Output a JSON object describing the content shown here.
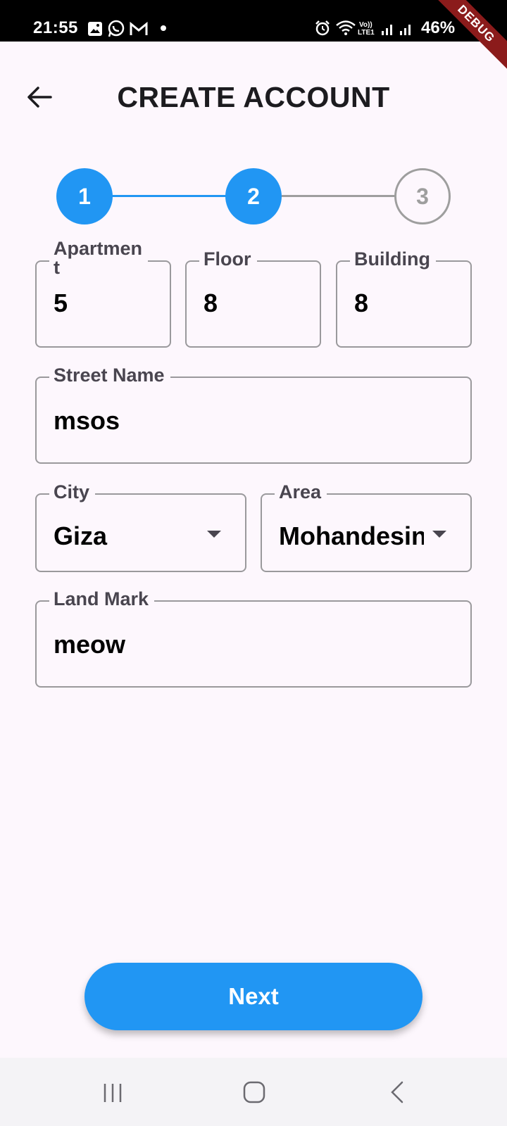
{
  "status_bar": {
    "time": "21:55",
    "battery": "46%",
    "debug_label": "DEBUG",
    "icons": [
      "gallery-icon",
      "whatsapp-icon",
      "gmail-icon",
      "alarm-icon",
      "wifi-icon",
      "volte-icon",
      "signal-icon",
      "signal-icon"
    ]
  },
  "header": {
    "title": "CREATE ACCOUNT",
    "back_icon": "arrow-back-icon"
  },
  "stepper": {
    "steps": [
      {
        "label": "1",
        "state": "active"
      },
      {
        "label": "2",
        "state": "active"
      },
      {
        "label": "3",
        "state": "inactive"
      }
    ],
    "active_color": "#2196f3",
    "inactive_color": "#9e9e9e"
  },
  "form": {
    "apartment": {
      "label": "Apartmen\nt",
      "value": "5"
    },
    "floor": {
      "label": "Floor",
      "value": "8"
    },
    "building": {
      "label": "Building",
      "value": "8"
    },
    "street_name": {
      "label": "Street Name",
      "value": "msos"
    },
    "city": {
      "label": "City",
      "value": "Giza"
    },
    "area": {
      "label": "Area",
      "value": "Mohandesin"
    },
    "land_mark": {
      "label": "Land Mark",
      "value": "meow"
    }
  },
  "actions": {
    "next_label": "Next"
  },
  "nav_bar": {
    "icons": [
      "recent-apps-icon",
      "home-icon",
      "back-icon"
    ]
  },
  "colors": {
    "primary": "#2196f3",
    "background": "#fdf7fd",
    "debug_ribbon": "#8b1b1b"
  }
}
